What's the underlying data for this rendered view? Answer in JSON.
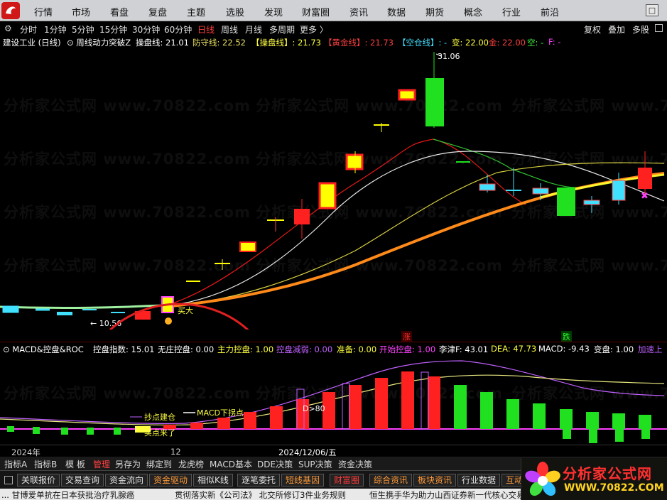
{
  "menu": [
    "行情",
    "市场",
    "看盘",
    "复盘",
    "主题",
    "选股",
    "发现",
    "财富圈",
    "资讯",
    "数据",
    "期货",
    "概念",
    "行业",
    "前沿"
  ],
  "window_button": "□",
  "period_bar": {
    "gear_icon": "⚙",
    "items": [
      "分时",
      "1分钟",
      "5分钟",
      "15分钟",
      "30分钟",
      "60分钟",
      "日线",
      "周线",
      "月线",
      "多周期",
      "更多 〉"
    ],
    "active": "日线",
    "right": [
      "复权",
      "叠加",
      "多股"
    ]
  },
  "info_bar": {
    "stock": "建设工业 (日线)",
    "indicator": "周线动力突破Z",
    "items": [
      {
        "text": "操盘线: 21.01",
        "color": "#ffffff"
      },
      {
        "text": "防守线: 22.52",
        "color": "#e8e060"
      },
      {
        "text": "【操盘线】: 21.73",
        "color": "#ffff40"
      },
      {
        "text": "【黄金线】: 21.73",
        "color": "#ff4040"
      },
      {
        "text": "【空仓线】: -",
        "color": "#40e0ff"
      },
      {
        "text": "变: 22.00",
        "color": "#ffff40"
      },
      {
        "text": "金: 22.00",
        "color": "#ff4040"
      },
      {
        "text": "空: -",
        "color": "#40ff40"
      },
      {
        "text": "F: -",
        "color": "#ff40ff"
      }
    ]
  },
  "price_chart": {
    "high_label": "31.06",
    "low_label": "← 10.56",
    "buy_label": "买大",
    "signal_up": "涨",
    "signal_down": "跌"
  },
  "macd_info": {
    "title": "MACD&控盘&ROC",
    "items": [
      {
        "text": "控盘指数: 15.01",
        "color": "#ffffff"
      },
      {
        "text": "无庄控盘: 0.00",
        "color": "#ffffff"
      },
      {
        "text": "主力控盘: 1.00",
        "color": "#ffff40"
      },
      {
        "text": "控盘减弱: 0.00",
        "color": "#c060ff"
      },
      {
        "text": "准备: 0.00",
        "color": "#ffff40"
      },
      {
        "text": "开始控盘: 1.00",
        "color": "#ff40ff"
      },
      {
        "text": "李津F: 43.01",
        "color": "#ffffff"
      },
      {
        "text": "DEA: 47.73",
        "color": "#ffff40"
      },
      {
        "text": "MACD: -9.43",
        "color": "#ffffff"
      },
      {
        "text": "变盘: 1.00",
        "color": "#ffffff"
      },
      {
        "text": "加速上",
        "color": "#c060ff"
      }
    ]
  },
  "macd_chart": {
    "labels": [
      "抄点建仓",
      "MACD下拐点",
      "买点来了",
      "D>80"
    ]
  },
  "date_axis": [
    "2024年",
    "12",
    "2024/12/06/五"
  ],
  "indicator_tabs": [
    "指标A",
    "指标B",
    "模 板",
    "管理",
    "另存为",
    "绑定到",
    "龙虎榜",
    "MACD基本",
    "DDE决策",
    "SUP决策",
    "资金决策"
  ],
  "active_tab": "管理",
  "function_bar": [
    {
      "label": "关联报价",
      "style": "normal"
    },
    {
      "label": "交易查询",
      "style": "normal"
    },
    {
      "label": "资金流向",
      "style": "normal"
    },
    {
      "label": "资金驱动",
      "style": "orange"
    },
    {
      "label": "相似K线",
      "style": "normal"
    },
    {
      "label": "逐笔委托",
      "style": "normal"
    },
    {
      "label": "短线基因",
      "style": "orange"
    },
    {
      "label": "财富圈",
      "style": "red"
    },
    {
      "label": "综合资讯",
      "style": "orange"
    },
    {
      "label": "板块资讯",
      "style": "orange"
    },
    {
      "label": "行业数据",
      "style": "normal"
    },
    {
      "label": "互动",
      "style": "orange"
    }
  ],
  "news": [
    "... 甘博爱单抗在日本获批治疗乳腺癌",
    "贯彻落实新《公司法》 北交所修订3件业务规则",
    "恒生携手华为助力山西证券新一代核心交易"
  ],
  "watermark": "分析家公式网 www.70822.com",
  "brand": {
    "name": "分析家公式网",
    "url": "WWW.70822.COM"
  },
  "colors": {
    "up_red": "#ff2020",
    "down_green": "#20e020",
    "up_yellow": "#ffff00",
    "cyan": "#40e0ff",
    "circle": "#e02020"
  }
}
